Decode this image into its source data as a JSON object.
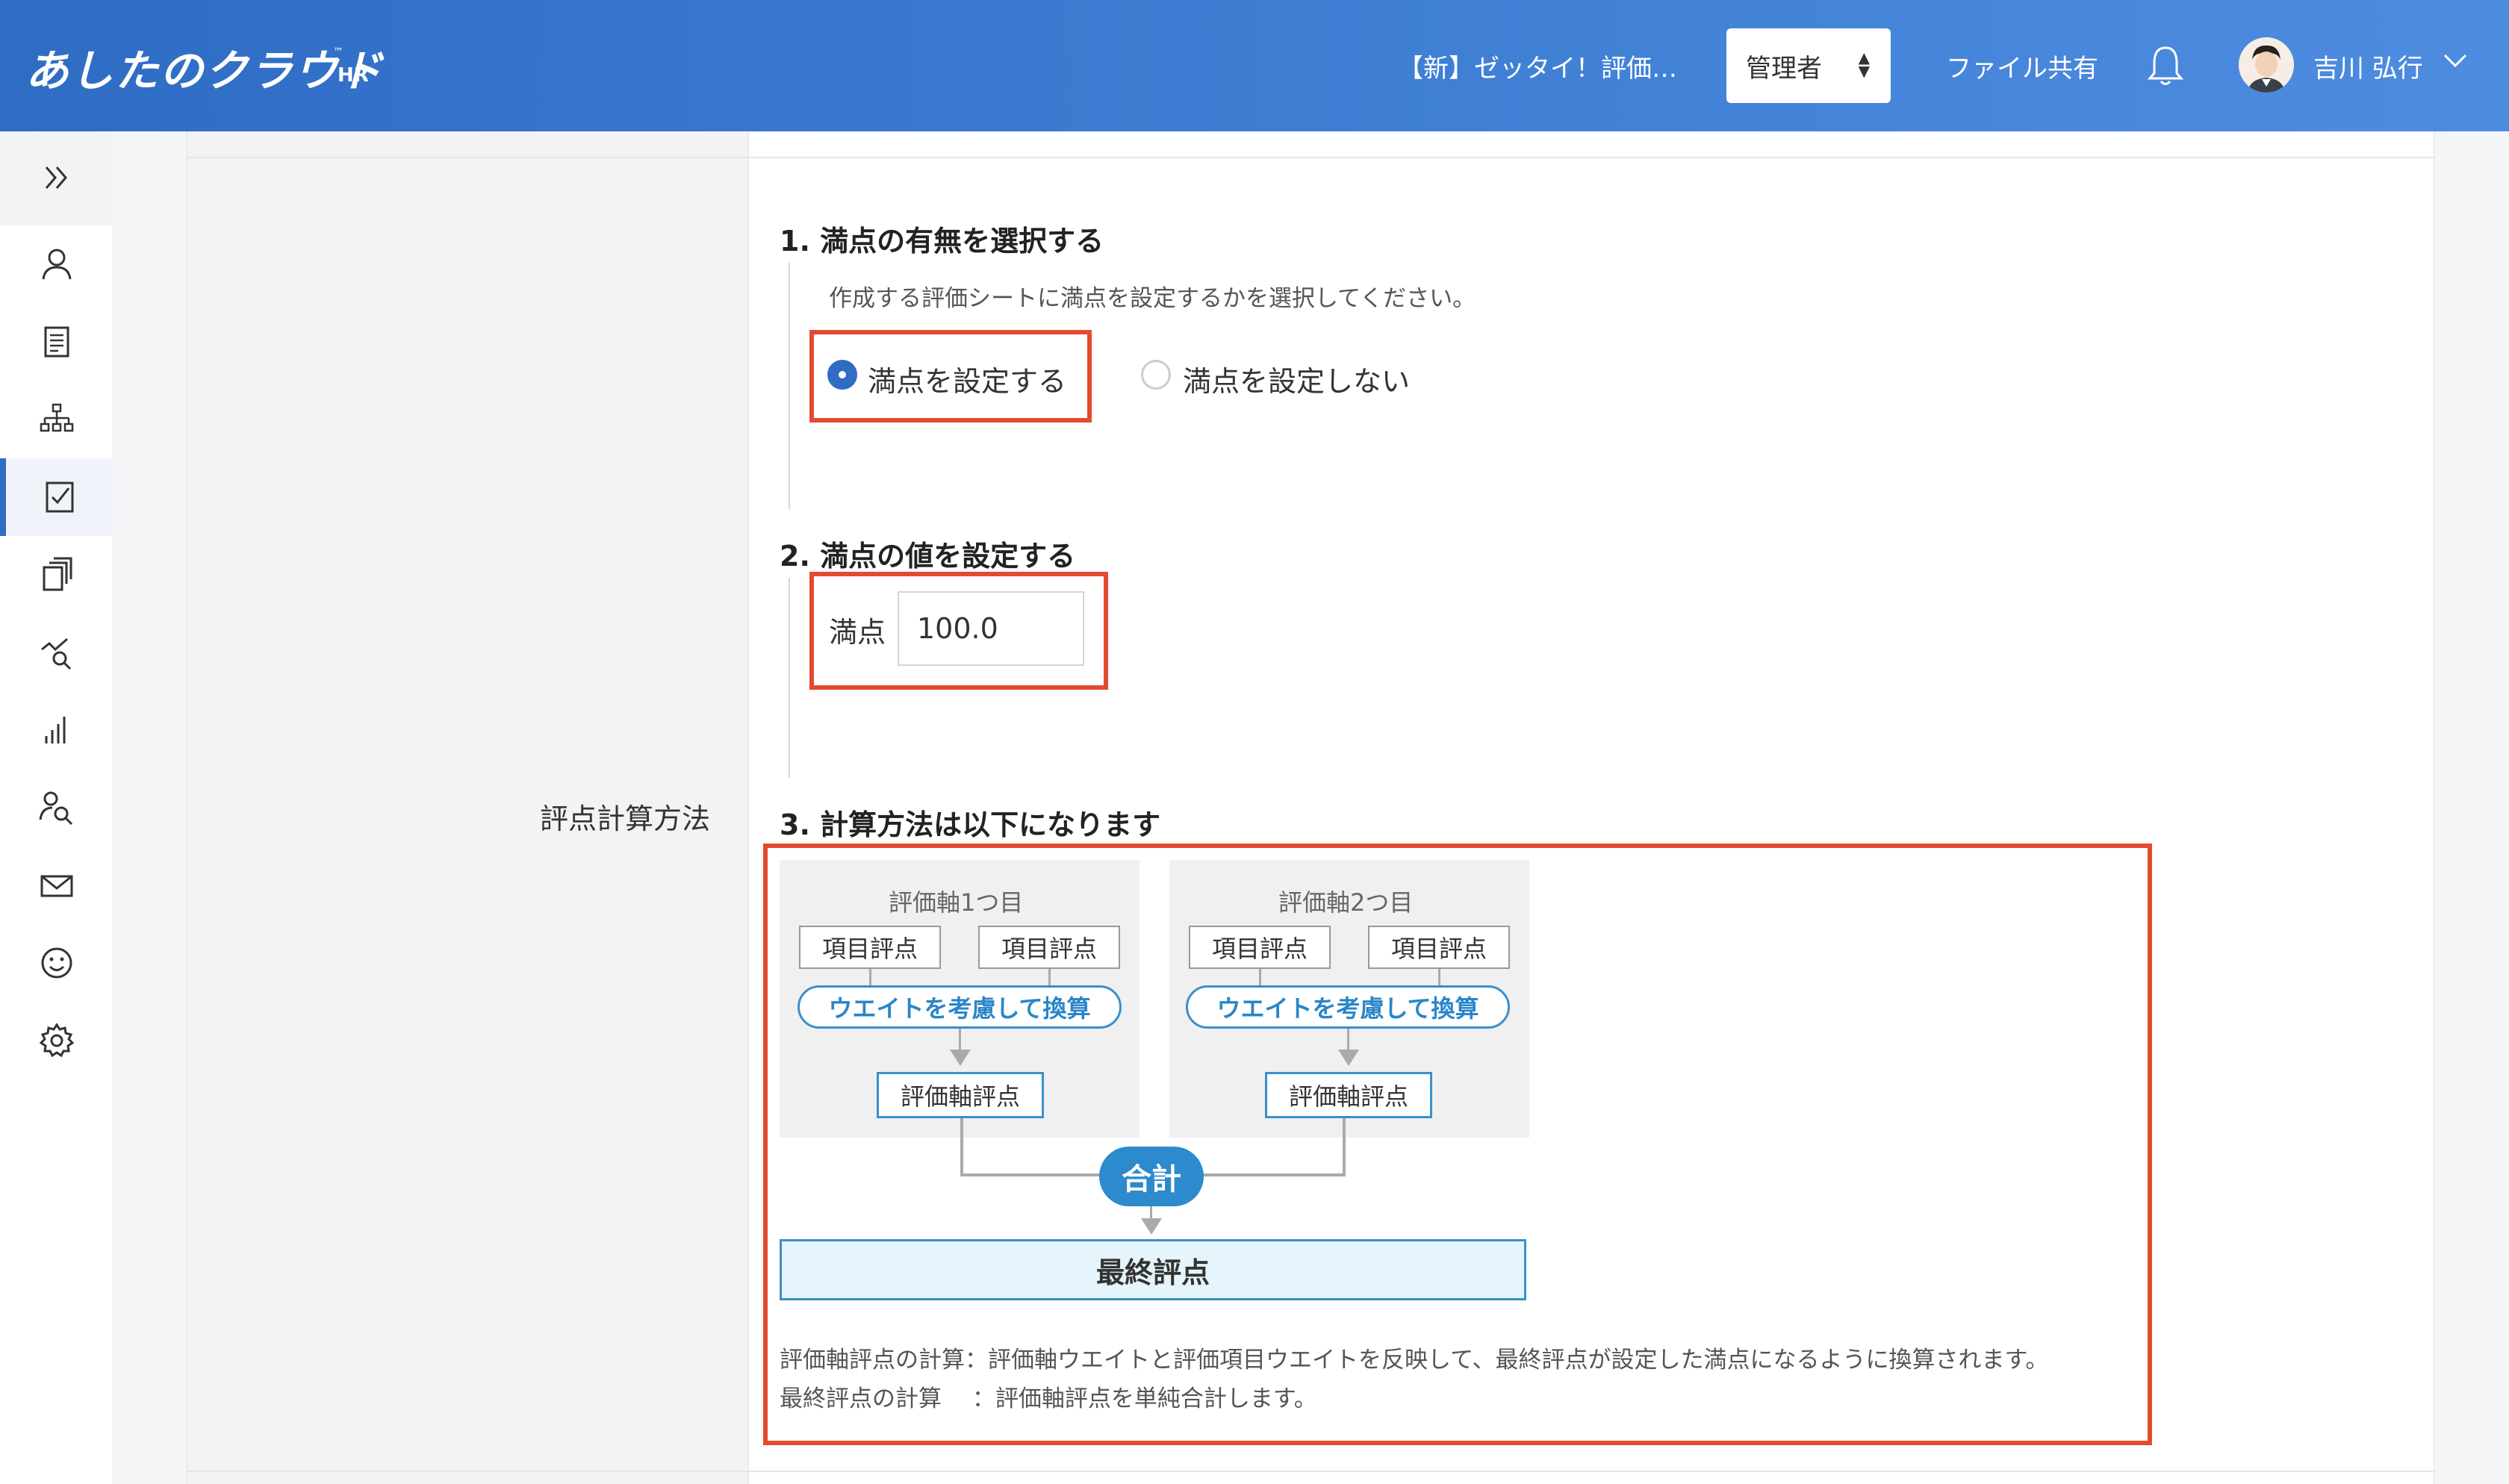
{
  "header": {
    "logo": "あしたのクラウド",
    "logo_sub": "HR",
    "logo_tm": "™",
    "title": "【新】ゼッタイ！評価…",
    "role": "管理者",
    "file_share": "ファイル共有",
    "user_name": "吉川 弘行"
  },
  "sidebar": {
    "items": [
      "double-chevron-icon",
      "person-icon",
      "document-icon",
      "org-chart-icon",
      "checklist-icon",
      "copy-icon",
      "analytics-search-icon",
      "bar-chart-icon",
      "person-search-icon",
      "mail-icon",
      "smile-icon",
      "gear-icon"
    ],
    "active_index": 4
  },
  "form": {
    "row_label": "評点計算方法",
    "section1": {
      "title": "1. 満点の有無を選択する",
      "description": "作成する評価シートに満点を設定するかを選択してください。",
      "option_on": "満点を設定する",
      "option_off": "満点を設定しない",
      "selected": "on"
    },
    "section2": {
      "title": "2. 満点の値を設定する",
      "label": "満点",
      "value": "100.0"
    },
    "section3": {
      "title": "3. 計算方法は以下になります",
      "axis1_title": "評価軸1つ目",
      "axis2_title": "評価軸2つ目",
      "item_score": "項目評点",
      "weight_convert": "ウエイトを考慮して換算",
      "axis_score": "評価軸評点",
      "sum": "合計",
      "final_score": "最終評点",
      "note1": "評価軸評点の計算：評価軸ウエイトと評価項目ウエイトを反映して、最終評点が設定した満点になるように換算されます。",
      "note2": "最終評点の計算　 ：評価軸評点を単純合計します。"
    }
  },
  "colors": {
    "header_blue": "#2f6cc4",
    "highlight_red": "#e34a31",
    "diagram_blue": "#3b8fcb"
  }
}
